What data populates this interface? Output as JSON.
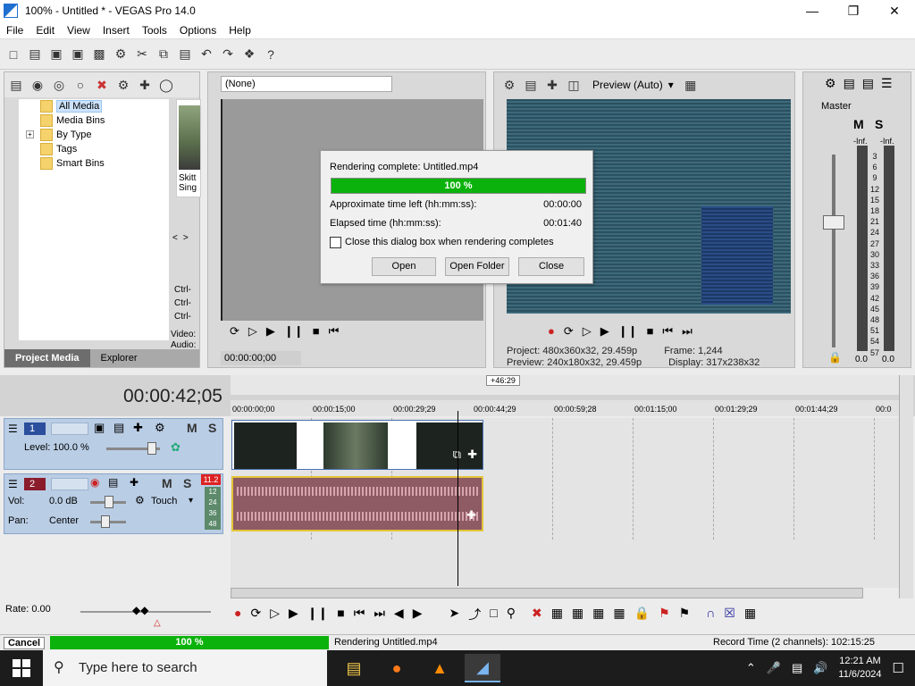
{
  "window": {
    "title": "100% - Untitled * - VEGAS Pro 14.0"
  },
  "menu": [
    "File",
    "Edit",
    "View",
    "Insert",
    "Tools",
    "Options",
    "Help"
  ],
  "project_media": {
    "tree": [
      {
        "label": "All Media",
        "selected": true
      },
      {
        "label": "Media Bins"
      },
      {
        "label": "By Type",
        "expandable": true,
        "expander": "+"
      },
      {
        "label": "Tags"
      },
      {
        "label": "Smart Bins"
      }
    ],
    "thumb_label": "Skitt Sing",
    "nav_prev": "<",
    "nav_next": ">",
    "ctrl_lines": [
      "Ctrl-",
      "Ctrl-",
      "Ctrl-"
    ],
    "info_lines": [
      "Video:",
      "Audio:"
    ],
    "tabs": [
      "Project Media",
      "Explorer"
    ]
  },
  "trimmer": {
    "selection": "(None)",
    "timecode": "00:00:00;00"
  },
  "preview": {
    "mode": "Preview (Auto)",
    "project_label": "Project:",
    "project_value": "480x360x32, 29.459p",
    "frame_label": "Frame:",
    "frame_value": "1,244",
    "preview_label": "Preview:",
    "preview_value": "240x180x32, 29.459p",
    "display_label": "Display:",
    "display_value": "317x238x32"
  },
  "master": {
    "title": "Master",
    "m": "M",
    "s": "S",
    "inf_left": "-Inf.",
    "inf_right": "-Inf.",
    "scale": [
      "3",
      "6",
      "9",
      "12",
      "15",
      "18",
      "21",
      "24",
      "27",
      "30",
      "33",
      "36",
      "39",
      "42",
      "45",
      "48",
      "51",
      "54",
      "57"
    ],
    "left_value": "0.0",
    "right_value": "0.0"
  },
  "render_dialog": {
    "title": "Rendering complete: Untitled.mp4",
    "progress_label": "100 %",
    "progress": 1.0,
    "time_left_label": "Approximate time left (hh:mm:ss):",
    "time_left_value": "00:00:00",
    "elapsed_label": "Elapsed time (hh:mm:ss):",
    "elapsed_value": "00:01:40",
    "close_checkbox_label": "Close this dialog box when rendering completes",
    "close_checked": false,
    "open_button": "Open",
    "open_folder_button": "Open Folder",
    "close_button": "Close"
  },
  "timeline": {
    "timecode": "00:00:42;05",
    "ruler_marks": [
      "00:00:00;00",
      "00:00:15;00",
      "00:00:29;29",
      "00:00:44;29",
      "00:00:59;28",
      "00:01:15;00",
      "00:01:29;29",
      "00:01:44;29",
      "00:0"
    ],
    "playhead_flag": "+46:29",
    "tracks": [
      {
        "num": "1",
        "level_label": "Level: 100.0 %",
        "m": "M",
        "s": "S"
      },
      {
        "num": "2",
        "vol_label": "Vol:",
        "vol_value": "0.0 dB",
        "pan_label": "Pan:",
        "pan_value": "Center",
        "automation": "Touch",
        "m": "M",
        "s": "S",
        "peak": "11.2",
        "meter_scale": [
          "12",
          "24",
          "36",
          "48"
        ]
      }
    ],
    "rate": "Rate: 0.00"
  },
  "status": {
    "cancel": "Cancel",
    "progress_label": "100 %",
    "progress": 1.0,
    "rendering_text": "Rendering Untitled.mp4",
    "record_time": "Record Time (2 channels): 102:15:25"
  },
  "taskbar": {
    "search_placeholder": "Type here to search",
    "time": "12:21 AM",
    "date": "11/6/2024"
  }
}
